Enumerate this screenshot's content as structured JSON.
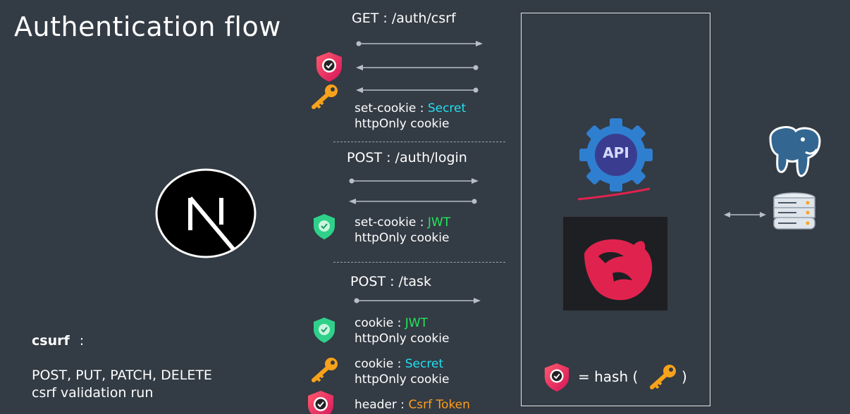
{
  "title": "Authentication flow",
  "section1": {
    "request": "GET : /auth/csrf",
    "cookie_prefix": "set-cookie : ",
    "cookie_value": "Secret",
    "cookie_note": "httpOnly cookie"
  },
  "section2": {
    "request": "POST : /auth/login",
    "cookie_prefix": "set-cookie : ",
    "cookie_value": "JWT",
    "cookie_note": "httpOnly cookie"
  },
  "section3": {
    "request": "POST : /task",
    "item1_prefix": "cookie : ",
    "item1_value": "JWT",
    "item1_note": "httpOnly cookie",
    "item2_prefix": "cookie : ",
    "item2_value": "Secret",
    "item2_note": "httpOnly cookie",
    "item3_prefix": "header : ",
    "item3_value": "Csrf Token"
  },
  "api_label": "API",
  "hash_prefix": "= hash (",
  "hash_suffix": ")",
  "csurf_title": "csurf",
  "csurf_colon": ":",
  "csurf_methods": "POST, PUT, PATCH, DELETE",
  "csurf_note": "csrf validation run",
  "colors": {
    "background": "#333b44",
    "secret": "#22e0f0",
    "jwt": "#22e85a",
    "csrf_token": "#ff9d1a",
    "nest_red": "#e0234e",
    "api_blue": "#2f7fd0"
  }
}
